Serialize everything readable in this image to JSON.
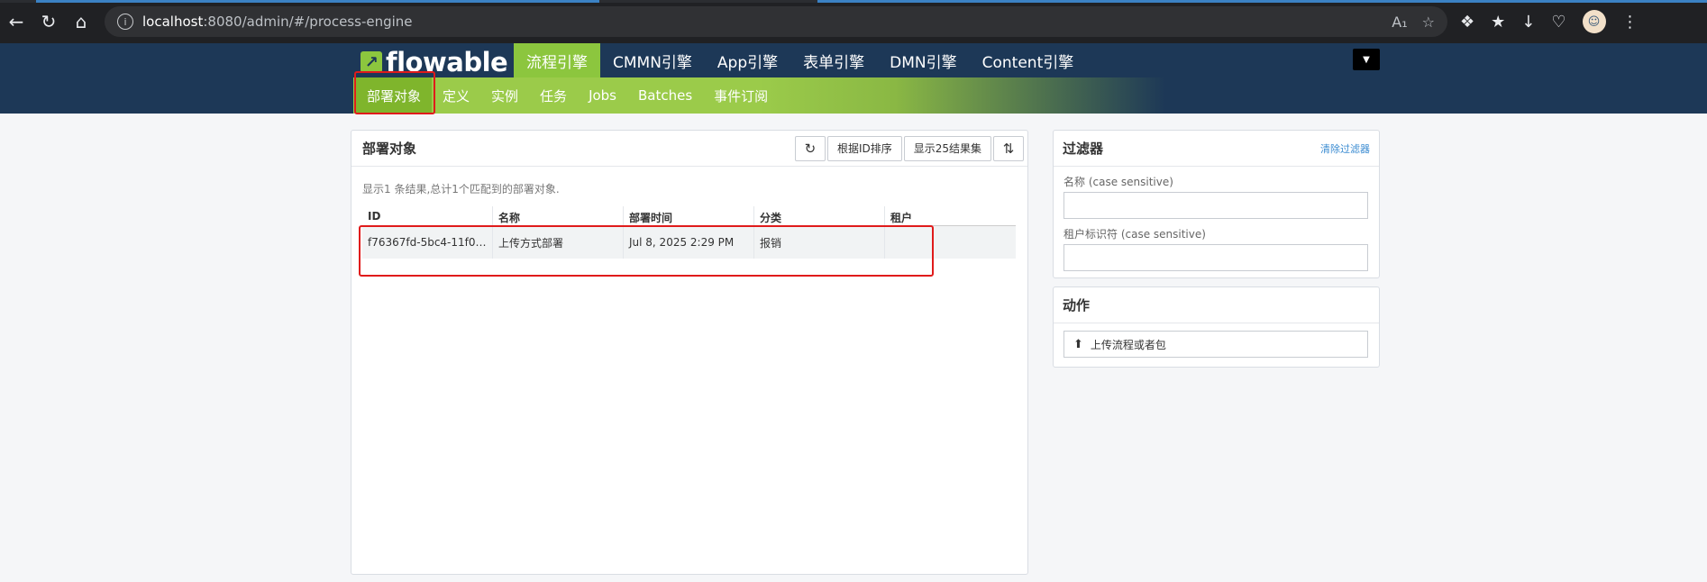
{
  "browser": {
    "url_host": "localhost",
    "url_path": ":8080/admin/#/process-engine",
    "info_glyph": "i"
  },
  "app": {
    "logo_text": "flowable",
    "engine_tabs": [
      "流程引擎",
      "CMMN引擎",
      "App引擎",
      "表单引擎",
      "DMN引擎",
      "Content引擎"
    ],
    "active_engine_index": 0,
    "subnav": [
      "部署对象",
      "定义",
      "实例",
      "任务",
      "Jobs",
      "Batches",
      "事件订阅"
    ],
    "active_subnav_index": 0
  },
  "main": {
    "title": "部署对象",
    "sort_label": "根据ID排序",
    "page_size_label": "显示25结果集",
    "summary": "显示1 条结果,总计1个匹配到的部署对象.",
    "columns": [
      "ID",
      "名称",
      "部署时间",
      "分类",
      "租户"
    ],
    "rows": [
      [
        "f76367fd-5bc4-11f0-9…",
        "上传方式部署",
        "Jul 8, 2025 2:29 PM",
        "报销",
        ""
      ]
    ]
  },
  "filter": {
    "title": "过滤器",
    "clear_label": "清除过滤器",
    "name_label": "名称 (case sensitive)",
    "name_value": "",
    "tenant_label": "租户标识符 (case sensitive)",
    "tenant_value": ""
  },
  "actions": {
    "title": "动作",
    "upload_label": "上传流程或者包"
  },
  "icons": {
    "back": "back-arrow-icon",
    "refresh": "refresh-icon",
    "home": "home-icon",
    "sort_direction": "sort-direction-icon",
    "upload": "upload-icon"
  }
}
